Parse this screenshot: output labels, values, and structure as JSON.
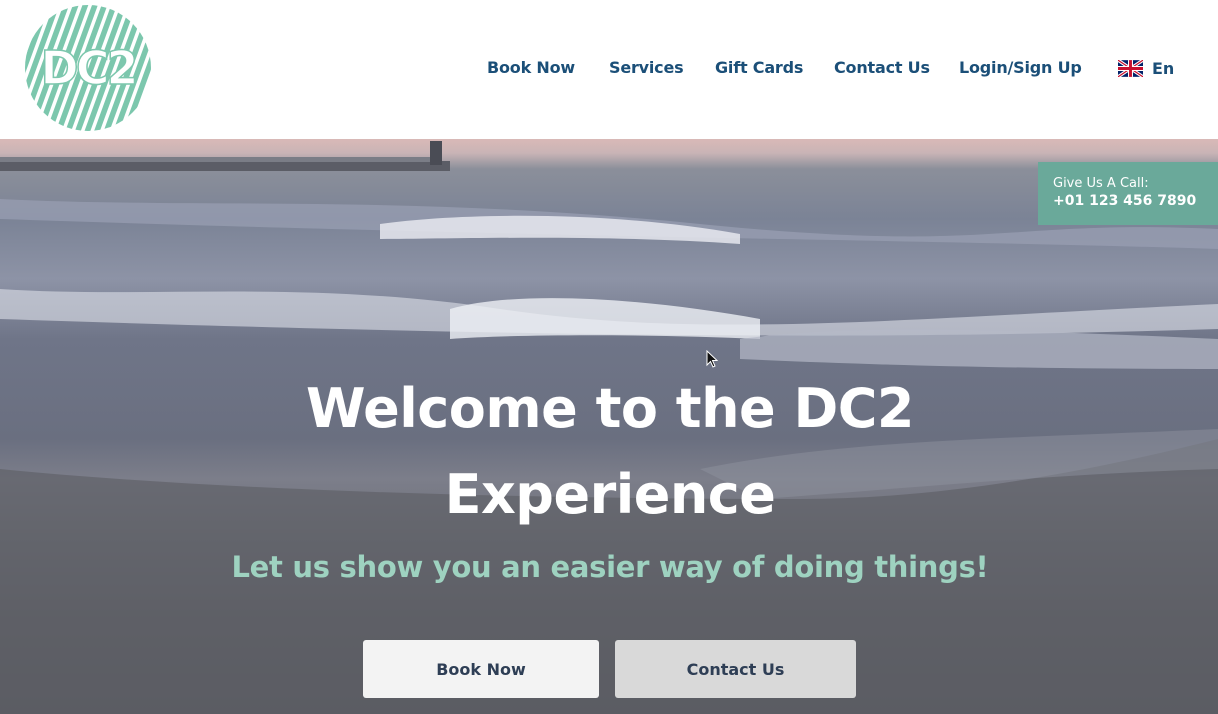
{
  "brand": {
    "logo_text": "DC2",
    "logo_color": "#7cc7ad"
  },
  "nav": {
    "items": [
      {
        "label": "Book Now"
      },
      {
        "label": "Services"
      },
      {
        "label": "Gift Cards"
      },
      {
        "label": "Contact Us"
      },
      {
        "label": "Login/Sign Up"
      }
    ],
    "language": {
      "icon": "uk-flag-icon",
      "label": "En"
    },
    "text_color": "#1b4f78"
  },
  "hero": {
    "call_box": {
      "label": "Give Us A Call:",
      "phone": "+01 123 456 7890",
      "color": "#6aa99a"
    },
    "headline_line1": "Welcome to the DC2",
    "headline_line2": "Experience",
    "subheadline": "Let us show you an easier way of doing things!",
    "subheadline_color": "#9ed2c0",
    "buttons": {
      "book": "Book Now",
      "contact": "Contact Us"
    }
  }
}
